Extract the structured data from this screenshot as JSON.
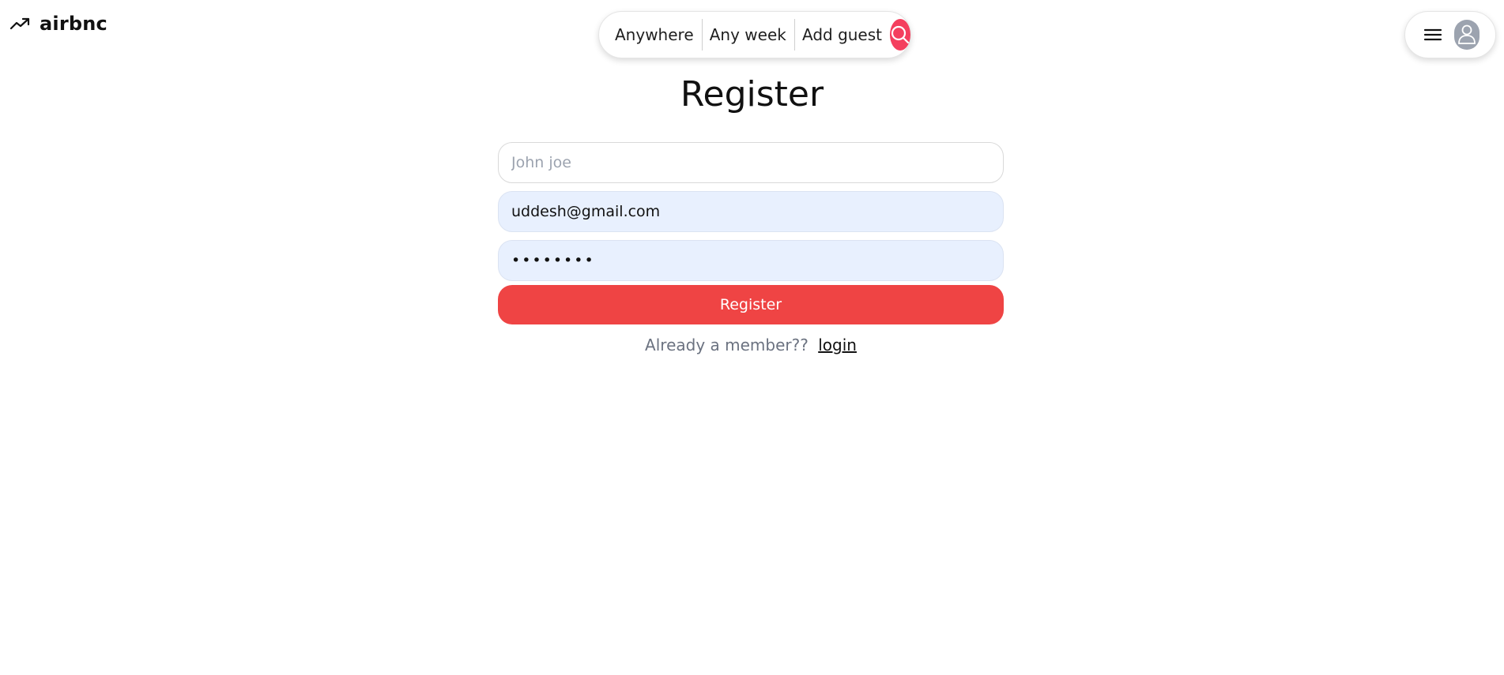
{
  "header": {
    "logo_text": "airbnc",
    "logo_icon": "trending-up-icon",
    "search": {
      "where": "Anywhere",
      "when": "Any week",
      "guests": "Add guest",
      "search_icon": "search-icon",
      "accent": "#f43f5e"
    },
    "user_menu": {
      "menu_icon": "hamburger-menu-icon",
      "avatar_icon": "user-avatar-icon"
    }
  },
  "register": {
    "title": "Register",
    "name_placeholder": "John joe",
    "name_value": "",
    "email_value": "uddesh@gmail.com",
    "password_value": "••••••••",
    "button_label": "Register",
    "button_color": "#ef4444",
    "already_member_text": "Already a member??",
    "login_link_text": "login"
  }
}
